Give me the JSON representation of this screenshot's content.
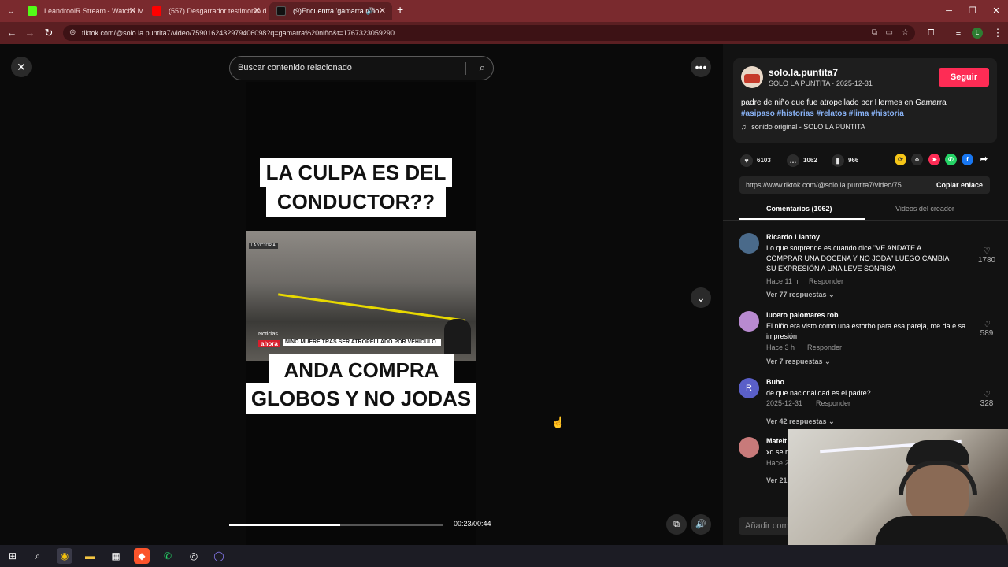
{
  "browser": {
    "tabs": [
      {
        "title": "LeandroolR Stream - Watch Liv",
        "icon_color": "#53fc18"
      },
      {
        "title": "(557) Desgarrador testimonio d",
        "icon_color": "#ff0000"
      },
      {
        "title": "(9)Encuentra 'gamarra niño",
        "icon_color": "#111111"
      }
    ],
    "new_tab": "+",
    "url": "tiktok.com/@solo.la.puntita7/video/7590162432979406098?q=gamarra%20niño&t=1767323059290",
    "profile_initial": "L"
  },
  "viewer": {
    "search_placeholder": "Buscar contenido relacionado",
    "caption_top": [
      "LA CULPA ES DEL",
      "CONDUCTOR??"
    ],
    "caption_bottom": [
      "ANDA COMPRA",
      "GLOBOS Y NO JODAS"
    ],
    "news_chyron": "NIÑO MUERE TRAS SER ATROPELLADO POR VEHÍCULO",
    "news_label": "Noticias",
    "news_brand": "ahora",
    "news_location": "LA VICTORIA",
    "time": "00:23/00:44",
    "progress": 0.52
  },
  "panel": {
    "username": "solo.la.puntita7",
    "display_name_date": "SOLO LA PUNTITA · 2025-12-31",
    "follow": "Seguir",
    "description": "padre de niño que fue atropellado por Hermes en Gamarra",
    "hashtags": [
      "#asipaso",
      "#historias",
      "#relatos",
      "#lima",
      "#historia"
    ],
    "sound": "sonido original - SOLO LA PUNTITA",
    "likes": "6103",
    "comments": "1062",
    "saves": "966",
    "link": "https://www.tiktok.com/@solo.la.puntita7/video/75...",
    "copy_link": "Copiar enlace",
    "tab_comments": "Comentarios (1062)",
    "tab_creator": "Videos del creador",
    "add_comment": "Añadir com",
    "comments_list": [
      {
        "name": "Ricardo Llantoy",
        "text": "Lo que sorprende es cuando dice \"VE ANDATE A COMPRAR UNA DOCENA Y NO JODA\" LUEGO CAMBIA SU EXPRESIÓN A UNA LEVE SONRISA",
        "time": "Hace 11 h",
        "reply": "Responder",
        "more": "Ver 77 respuestas",
        "likes": "1780",
        "avatar_color": "#4a6a8a",
        "initial": ""
      },
      {
        "name": "lucero palomares rob",
        "text": "El niño era visto como una estorbo para esa pareja, me da e sa impresión",
        "time": "Hace 3 h",
        "reply": "Responder",
        "more": "Ver 7 respuestas",
        "likes": "589",
        "avatar_color": "#b88ad0",
        "initial": ""
      },
      {
        "name": "Buho",
        "text": "de que nacionalidad es el padre?",
        "time": "2025-12-31",
        "reply": "Responder",
        "more": "Ver 42 respuestas",
        "likes": "328",
        "avatar_color": "#5a5fc8",
        "initial": "R"
      },
      {
        "name": "Mateit",
        "text": "xq se r",
        "time": "Hace 2",
        "reply": "",
        "more": "Ver 21",
        "likes": "",
        "avatar_color": "#c87a7a",
        "initial": ""
      }
    ]
  }
}
